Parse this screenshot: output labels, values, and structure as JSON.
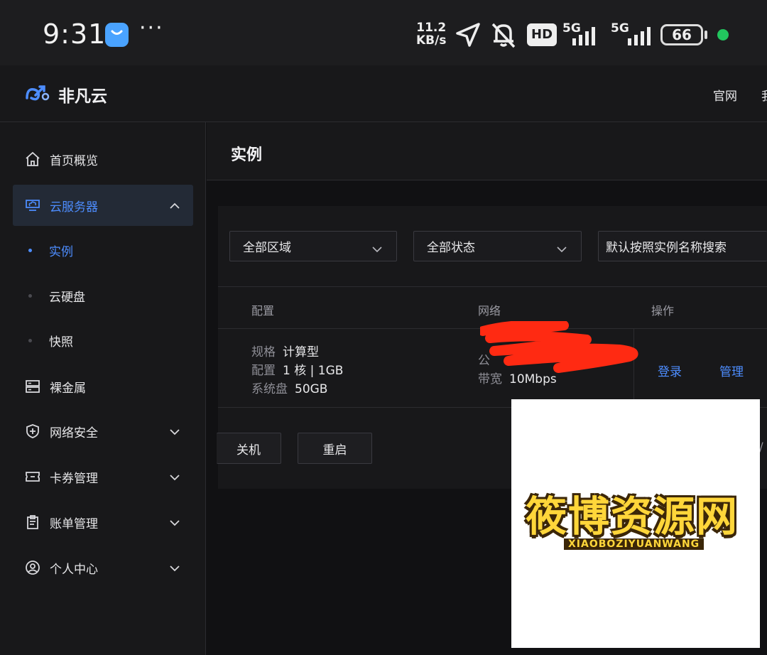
{
  "status_bar": {
    "time": "9:31",
    "dots": "···",
    "speed_value": "11.2",
    "speed_unit": "KB/s",
    "hd_label": "HD",
    "net1": "5G",
    "net2": "5G",
    "battery": "66",
    "icons": [
      "app-store-icon",
      "location-arrow-icon",
      "mute-bell-icon",
      "hd-voice-icon",
      "signal-5g-icon",
      "signal-5g-icon",
      "battery-icon",
      "green-dot-icon"
    ]
  },
  "header": {
    "brand": "非凡云",
    "nav_links": [
      "官网",
      "我"
    ]
  },
  "sidebar": {
    "items": [
      {
        "label": "首页概览",
        "icon": "home-icon"
      },
      {
        "label": "云服务器",
        "icon": "cloud-server-icon",
        "active": true,
        "expanded": true
      },
      {
        "label": "裸金属",
        "icon": "server-rack-icon"
      },
      {
        "label": "网络安全",
        "icon": "shield-icon"
      },
      {
        "label": "卡券管理",
        "icon": "ticket-icon"
      },
      {
        "label": "账单管理",
        "icon": "clipboard-icon"
      },
      {
        "label": "个人中心",
        "icon": "user-circle-icon"
      }
    ],
    "sub_items": [
      {
        "label": "实例",
        "active": true
      },
      {
        "label": "云硬盘"
      },
      {
        "label": "快照"
      }
    ]
  },
  "main": {
    "title": "实例",
    "filters": {
      "region": "全部区域",
      "status": "全部状态",
      "search_placeholder": "默认按照实例名称搜索"
    },
    "table": {
      "headers": [
        "配置",
        "网络",
        "操作"
      ],
      "row": {
        "spec_key": "规格",
        "spec_val": "计算型",
        "config_key": "配置",
        "config_val": "1 核 | 1GB",
        "disk_key": "系统盘",
        "disk_val": "50GB",
        "ip_key": "公",
        "bw_key": "带宽",
        "bw_val": "10Mbps",
        "actions": [
          "登录",
          "管理"
        ]
      }
    },
    "buttons": [
      "关机",
      "重启"
    ],
    "pager_fragment": "/"
  },
  "watermark": {
    "title": "筱博资源网",
    "subtitle": "XIAOBOZIYUANWANG"
  },
  "colors": {
    "accent": "#4d8dff",
    "background": "#111113",
    "panel": "#18181a",
    "redaction": "#ff2a12"
  }
}
